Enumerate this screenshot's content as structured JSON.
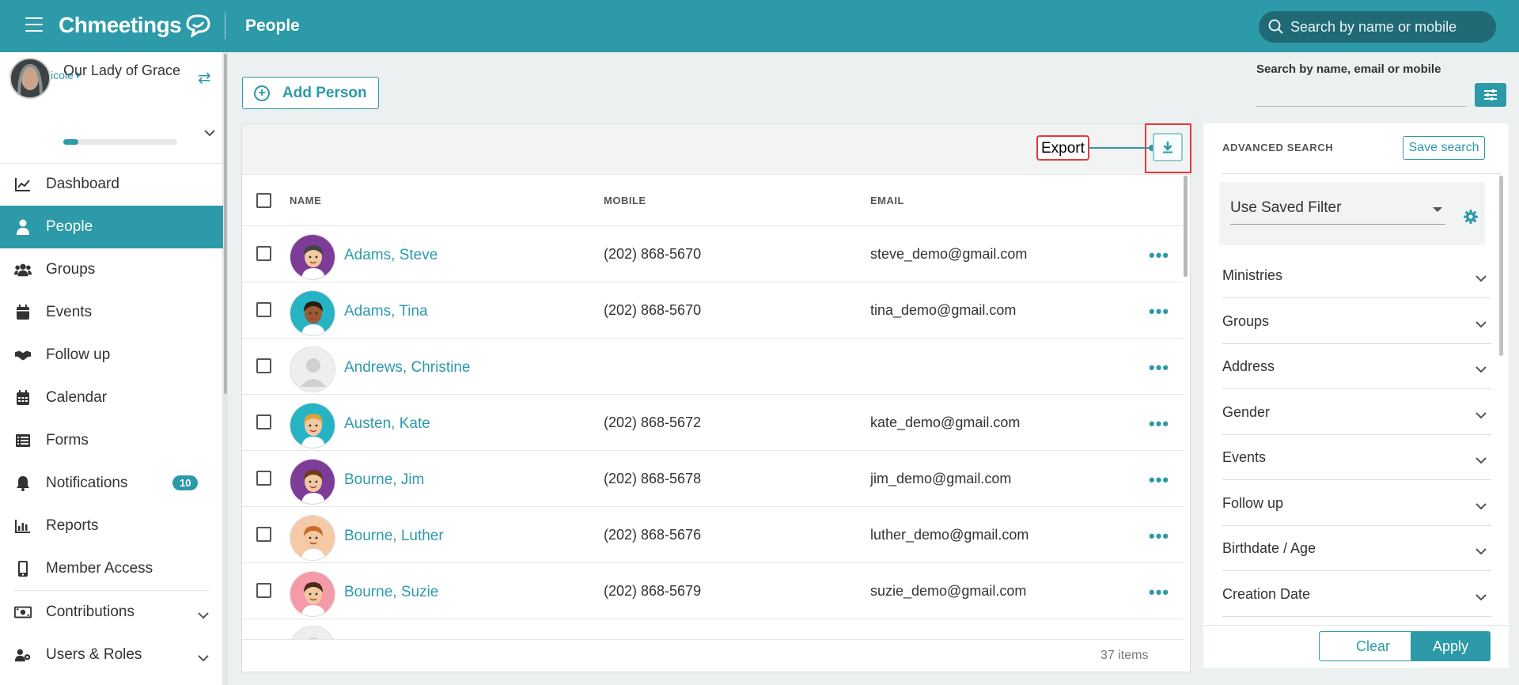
{
  "app": {
    "logo": "Chmeetings",
    "page_title": "People"
  },
  "top_search": {
    "placeholder": "Search by name or mobile"
  },
  "user": {
    "name": "Nicole"
  },
  "church": {
    "name": "Our Lady of Grace",
    "progress": 0.13
  },
  "nav": [
    {
      "label": "Dashboard",
      "icon": "chart-line-icon",
      "active": false
    },
    {
      "label": "People",
      "icon": "person-icon",
      "active": true
    },
    {
      "label": "Groups",
      "icon": "users-icon",
      "active": false
    },
    {
      "label": "Events",
      "icon": "calendar-icon",
      "active": false
    },
    {
      "label": "Follow up",
      "icon": "handshake-icon",
      "active": false
    },
    {
      "label": "Calendar",
      "icon": "calendar-grid-icon",
      "active": false
    },
    {
      "label": "Forms",
      "icon": "list-icon",
      "active": false
    },
    {
      "label": "Notifications",
      "icon": "bell-icon",
      "active": false,
      "badge": "10"
    },
    {
      "label": "Reports",
      "icon": "bar-chart-icon",
      "active": false
    },
    {
      "label": "Member Access",
      "icon": "mobile-icon",
      "active": false
    },
    {
      "label": "Contributions",
      "icon": "money-icon",
      "active": false,
      "expandable": true
    },
    {
      "label": "Users & Roles",
      "icon": "users-gear-icon",
      "active": false,
      "expandable": true
    }
  ],
  "toolbar": {
    "add_person": "Add Person",
    "export_label": "Export"
  },
  "right_search": {
    "label": "Search by name, email or mobile"
  },
  "table": {
    "headers": {
      "name": "NAME",
      "mobile": "MOBILE",
      "email": "EMAIL"
    },
    "rows": [
      {
        "name": "Adams, Steve",
        "mobile": "(202) 868-5670",
        "email": "steve_demo@gmail.com"
      },
      {
        "name": "Adams, Tina",
        "mobile": "(202) 868-5670",
        "email": "tina_demo@gmail.com"
      },
      {
        "name": "Andrews, Christine",
        "mobile": "",
        "email": ""
      },
      {
        "name": "Austen, Kate",
        "mobile": "(202) 868-5672",
        "email": "kate_demo@gmail.com"
      },
      {
        "name": "Bourne, Jim",
        "mobile": "(202) 868-5678",
        "email": "jim_demo@gmail.com"
      },
      {
        "name": "Bourne, Luther",
        "mobile": "(202) 868-5676",
        "email": "luther_demo@gmail.com"
      },
      {
        "name": "Bourne, Suzie",
        "mobile": "(202) 868-5679",
        "email": "suzie_demo@gmail.com"
      }
    ],
    "row_menu": "•••",
    "count": "37 items"
  },
  "advanced_search": {
    "title": "ADVANCED SEARCH",
    "save_label": "Save search",
    "saved_filter": "Use Saved Filter",
    "filters": [
      "Ministries",
      "Groups",
      "Address",
      "Gender",
      "Events",
      "Follow up",
      "Birthdate / Age",
      "Creation Date"
    ],
    "clear_label": "Clear",
    "apply_label": "Apply"
  },
  "colors": {
    "accent": "#2c9aa8",
    "highlight": "#e23a3a"
  }
}
